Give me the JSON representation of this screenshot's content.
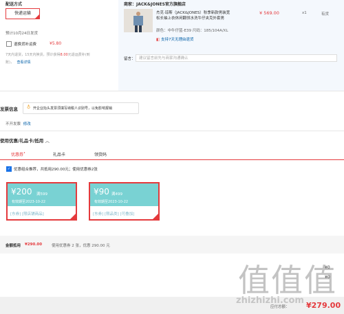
{
  "shipping": {
    "section_title": "配送方式",
    "method_label": "快递运输",
    "estimate": "预计10月24日发货",
    "insurance_label": "退换货补运费",
    "insurance_price": "¥5.80",
    "insurance_desc_1": "7天内退货，15天内换货，预计获得",
    "insurance_desc_amount": "8.00",
    "insurance_desc_2": "元退运费补(到",
    "insurance_desc_3": "账)，",
    "insurance_link": "查看详情"
  },
  "seller": {
    "store_name": "商家：JACK&JONES官方旗舰店",
    "product_title_1": "杰克·琼斯（JACK&JONES）秋季新款男装宽",
    "product_title_2": "松长袖上衣休闲翻领水洗牛仔夹克外套男",
    "price": "¥ 569.00",
    "qty": "x1",
    "stock": "有货",
    "spec": "颜色：中牛仔蓝-E39   尺码：185/104A/XL",
    "return_policy": "支持7天无理由退货",
    "remark_label": "留言：",
    "remark_placeholder": "建议留言前先与商家沟通确认"
  },
  "invoice": {
    "title": "发票信息",
    "tip": "开企业抬头发票须填写纳税人识别号，以免影响报销",
    "status": "不开发票",
    "modify_link": "修改"
  },
  "coupons": {
    "title": "使用优惠/礼品卡/抵用",
    "tabs": [
      "优惠券",
      "礼品卡",
      "领货码"
    ],
    "combo_text": "优惠组合推荐，共抵用290.00元；使用优惠券2张",
    "items": [
      {
        "amount": "¥200",
        "condition": "满599",
        "valid": "有效期至2023-10-22",
        "tags": "[东券]  [限店铺商品]"
      },
      {
        "amount": "¥90",
        "condition": "满499",
        "valid": "有效期至2023-10-22",
        "tags": "[东券]  [限品类]  [可叠加]"
      }
    ]
  },
  "summary": {
    "label": "金额抵用",
    "amount": "¥290.00",
    "desc": "使用优惠券 2 张，优惠 290.00 元",
    "total_label": "应付总额：",
    "total": "¥279.00",
    "partial_1": "¥0",
    "partial_2": "¥0"
  },
  "watermark": {
    "text": "zhizhizhi.com",
    "glyphs": "值值值"
  }
}
